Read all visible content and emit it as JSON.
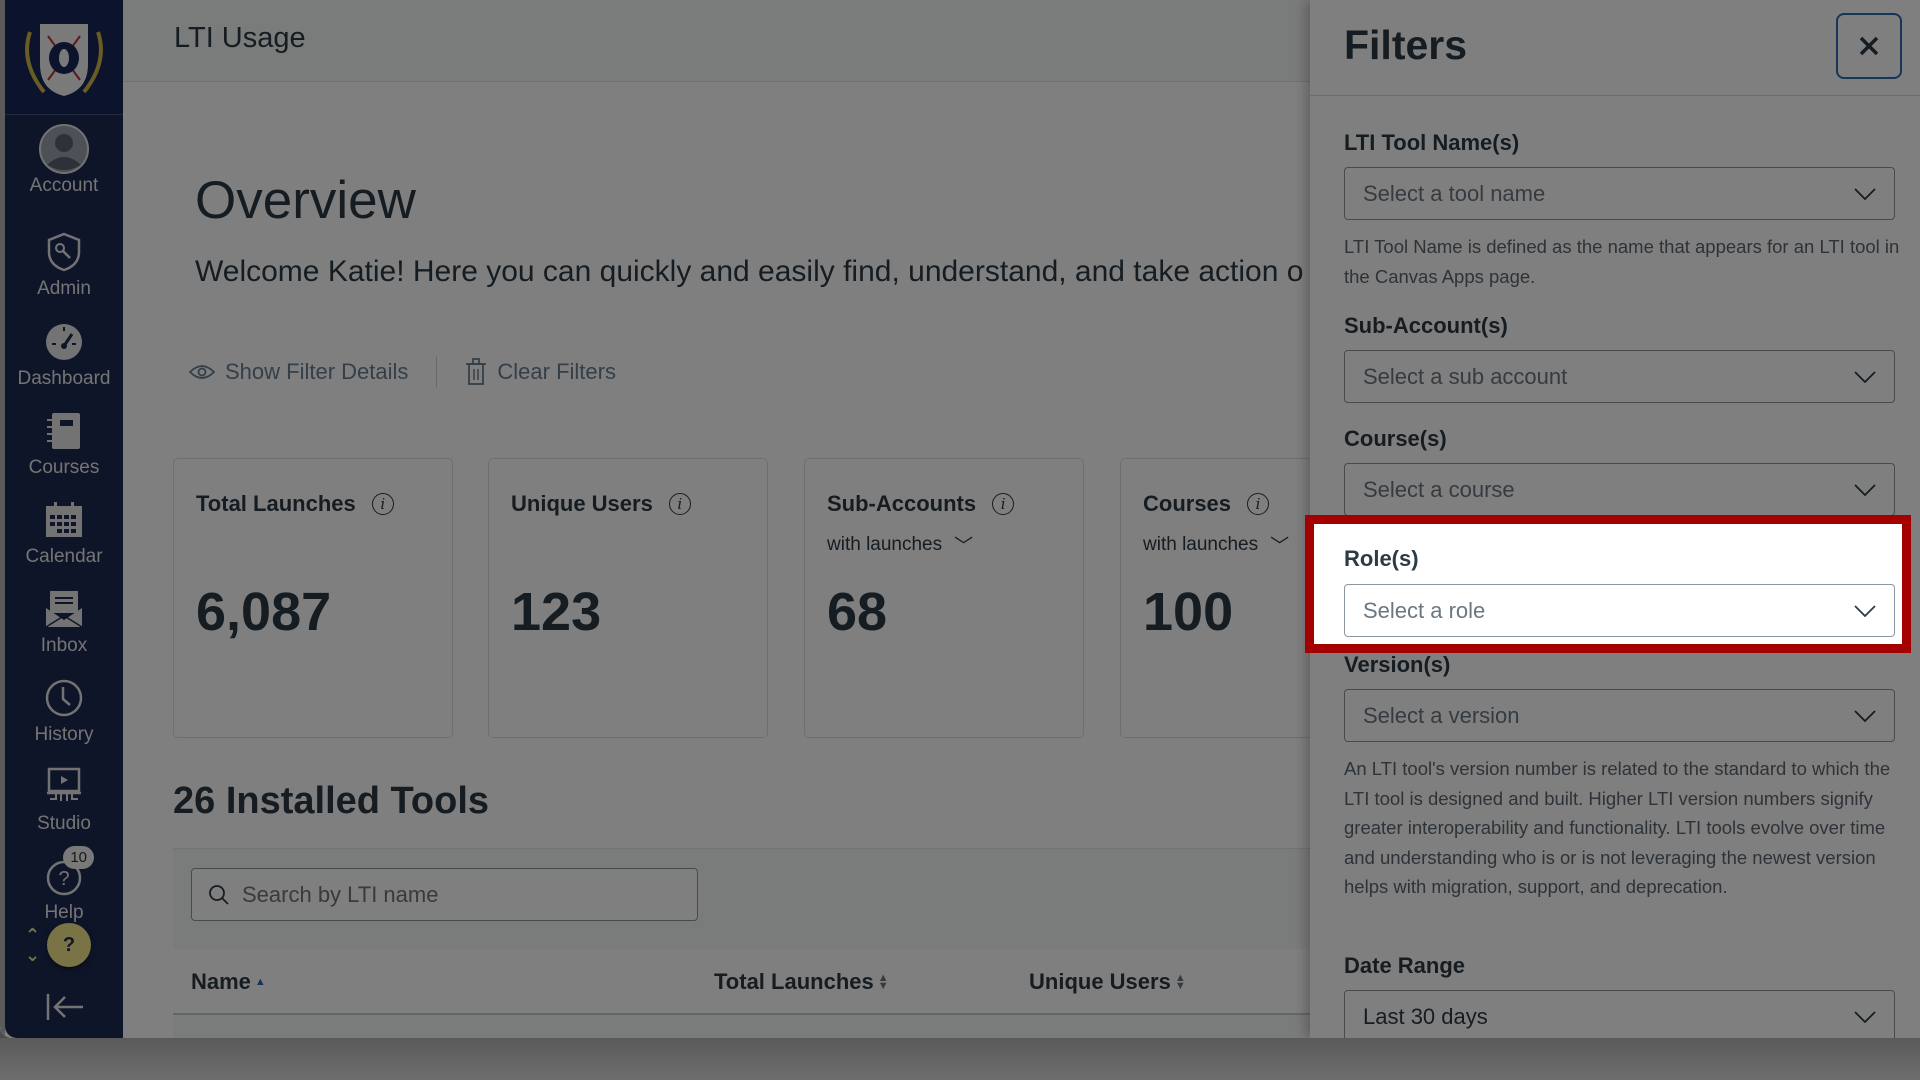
{
  "sidebar": {
    "items": [
      {
        "label": "Account",
        "icon": "account-avatar-icon"
      },
      {
        "label": "Admin",
        "icon": "admin-shield-key-icon"
      },
      {
        "label": "Dashboard",
        "icon": "dashboard-gauge-icon"
      },
      {
        "label": "Courses",
        "icon": "courses-notebook-icon"
      },
      {
        "label": "Calendar",
        "icon": "calendar-icon"
      },
      {
        "label": "Inbox",
        "icon": "inbox-envelope-icon"
      },
      {
        "label": "History",
        "icon": "history-clock-icon"
      },
      {
        "label": "Studio",
        "icon": "studio-screen-icon"
      },
      {
        "label": "Help",
        "icon": "help-question-icon",
        "badge": "10"
      }
    ],
    "help_fab": "?",
    "collapse_icon": "collapse-arrow-left-icon"
  },
  "header": {
    "title": "LTI Usage"
  },
  "overview": {
    "title": "Overview",
    "welcome": "Welcome Katie! Here you can quickly and easily find, understand, and take action o",
    "show_filter_details": "Show Filter Details",
    "clear_filters": "Clear Filters"
  },
  "cards": [
    {
      "title": "Total Launches",
      "value": "6,087"
    },
    {
      "title": "Unique Users",
      "value": "123"
    },
    {
      "title": "Sub-Accounts",
      "subtitle": "with launches",
      "value": "68"
    },
    {
      "title": "Courses",
      "subtitle": "with launches",
      "value": "100"
    }
  ],
  "tools": {
    "title": "26 Installed Tools",
    "search_placeholder": "Search by LTI name",
    "columns": [
      {
        "label": "Name",
        "sort": "ascending"
      },
      {
        "label": "Total Launches",
        "sort": "none"
      },
      {
        "label": "Unique Users",
        "sort": "none"
      }
    ]
  },
  "filters": {
    "title": "Filters",
    "close_label": "×",
    "tool_name": {
      "label": "LTI Tool Name(s)",
      "placeholder": "Select a tool name",
      "help": "LTI Tool Name is defined as the name that appears for an LTI tool in the Canvas Apps page."
    },
    "sub_account": {
      "label": "Sub-Account(s)",
      "placeholder": "Select a sub account"
    },
    "course": {
      "label": "Course(s)",
      "placeholder": "Select a course"
    },
    "role": {
      "label": "Role(s)",
      "placeholder": "Select a role"
    },
    "version": {
      "label": "Version(s)",
      "placeholder": "Select a version",
      "help": "An LTI tool's version number is related to the standard to which the LTI tool is designed and built. Higher LTI version numbers signify greater interoperability and functionality. LTI tools evolve over time and understanding who is or is not leveraging the newest version helps with migration, support, and deprecation."
    },
    "date_range": {
      "label": "Date Range",
      "value": "Last 30 days"
    }
  },
  "highlight": {
    "target": "Role(s)",
    "color": "#a50000"
  }
}
